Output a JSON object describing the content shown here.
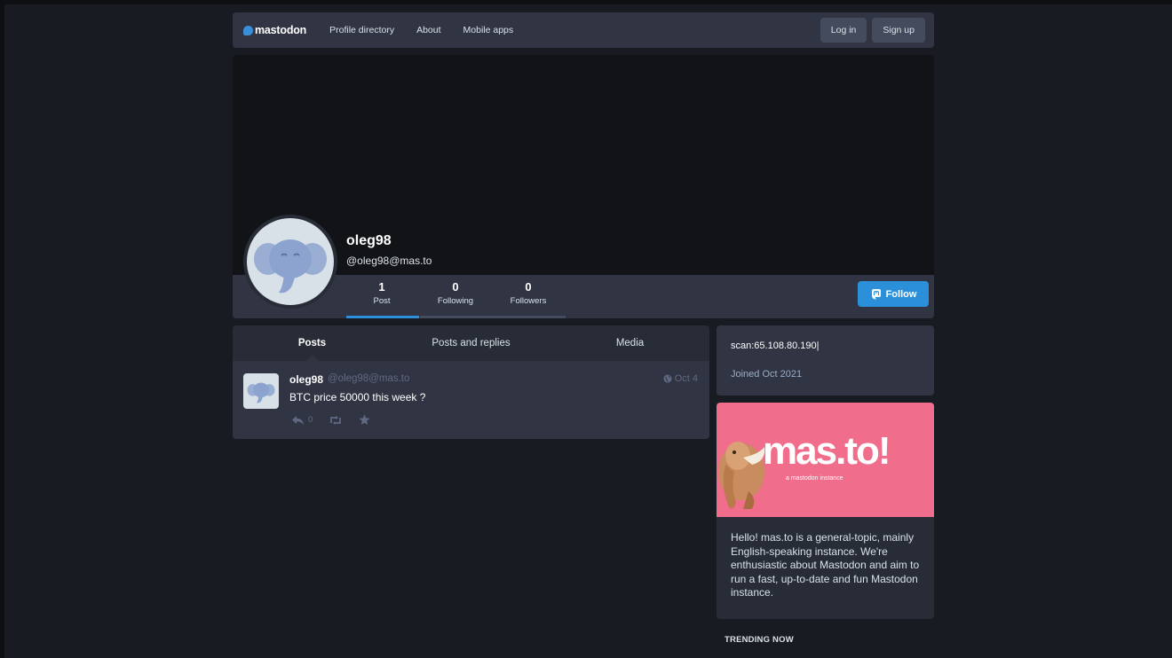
{
  "nav": {
    "logo_text": "mastodon",
    "links": [
      "Profile directory",
      "About",
      "Mobile apps"
    ],
    "login_label": "Log in",
    "signup_label": "Sign up"
  },
  "profile": {
    "display_name": "oleg98",
    "acct": "@oleg98@mas.to",
    "counters": [
      {
        "value": "1",
        "label": "Post"
      },
      {
        "value": "0",
        "label": "Following"
      },
      {
        "value": "0",
        "label": "Followers"
      }
    ],
    "follow_label": "Follow",
    "note": "scan:65.108.80.190|",
    "joined": "Joined Oct 2021"
  },
  "tabs": [
    "Posts",
    "Posts and replies",
    "Media"
  ],
  "status": {
    "display_name": "oleg98",
    "acct": "@oleg98@mas.to",
    "time": "Oct 4",
    "text": "BTC price 50000 this week ?",
    "reply_count": "0"
  },
  "server": {
    "hero_title": "mas.to!",
    "hero_subtitle": "a mastodon instance",
    "description": "Hello! mas.to is a general-topic, mainly English-speaking instance. We're enthusiastic about Mastodon and aim to run a fast, up-to-date and fun Mastodon instance."
  },
  "trending_label": "TRENDING NOW",
  "colors": {
    "background": "#191b22",
    "accent": "#2b90d9",
    "hero": "#f06d8c"
  }
}
